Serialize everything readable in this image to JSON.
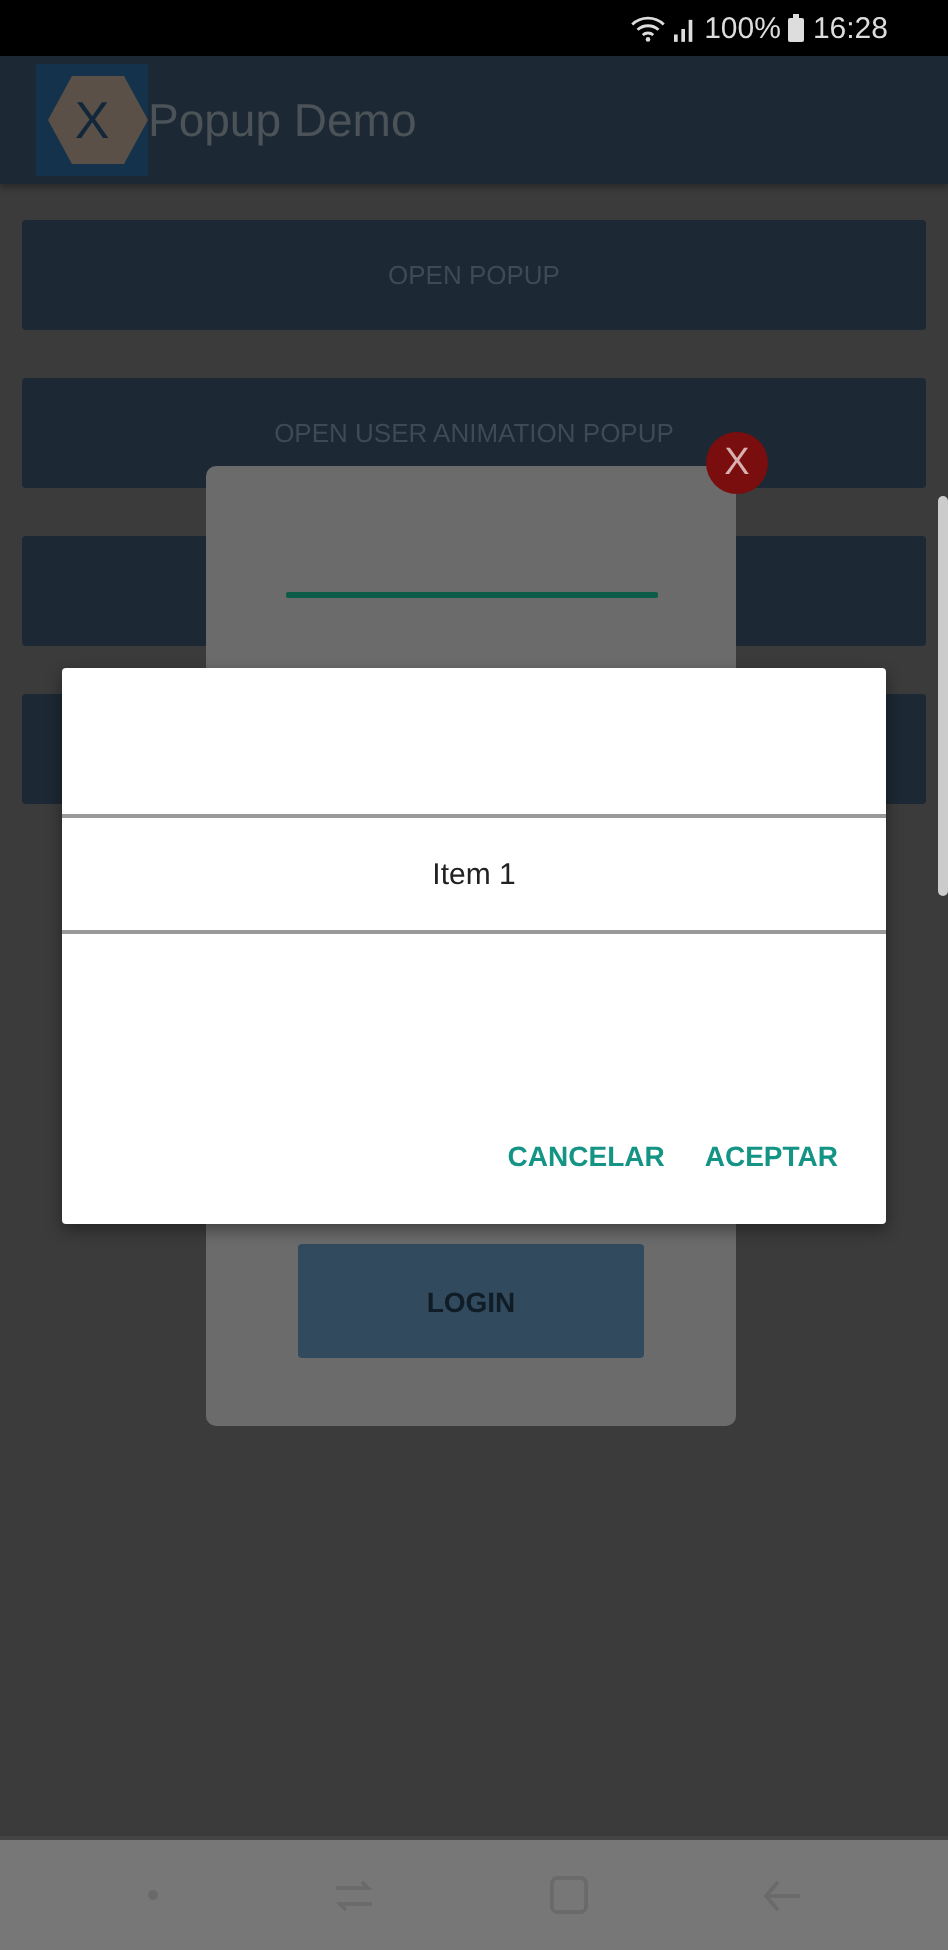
{
  "status_bar": {
    "battery": "100%",
    "time": "16:28"
  },
  "app_bar": {
    "title": "Popup Demo",
    "logo_letter": "X"
  },
  "buttons": [
    {
      "kind": "labeled",
      "label": "OPEN POPUP"
    },
    {
      "kind": "labeled",
      "label": "OPEN USER ANIMATION POPUP"
    },
    {
      "kind": "blank"
    },
    {
      "kind": "blank"
    }
  ],
  "login_popup": {
    "close_label": "X",
    "login_button": "LOGIN"
  },
  "dialog": {
    "items": [
      "Item 1"
    ],
    "buttons": [
      "CANCELAR",
      "ACEPTAR"
    ]
  }
}
